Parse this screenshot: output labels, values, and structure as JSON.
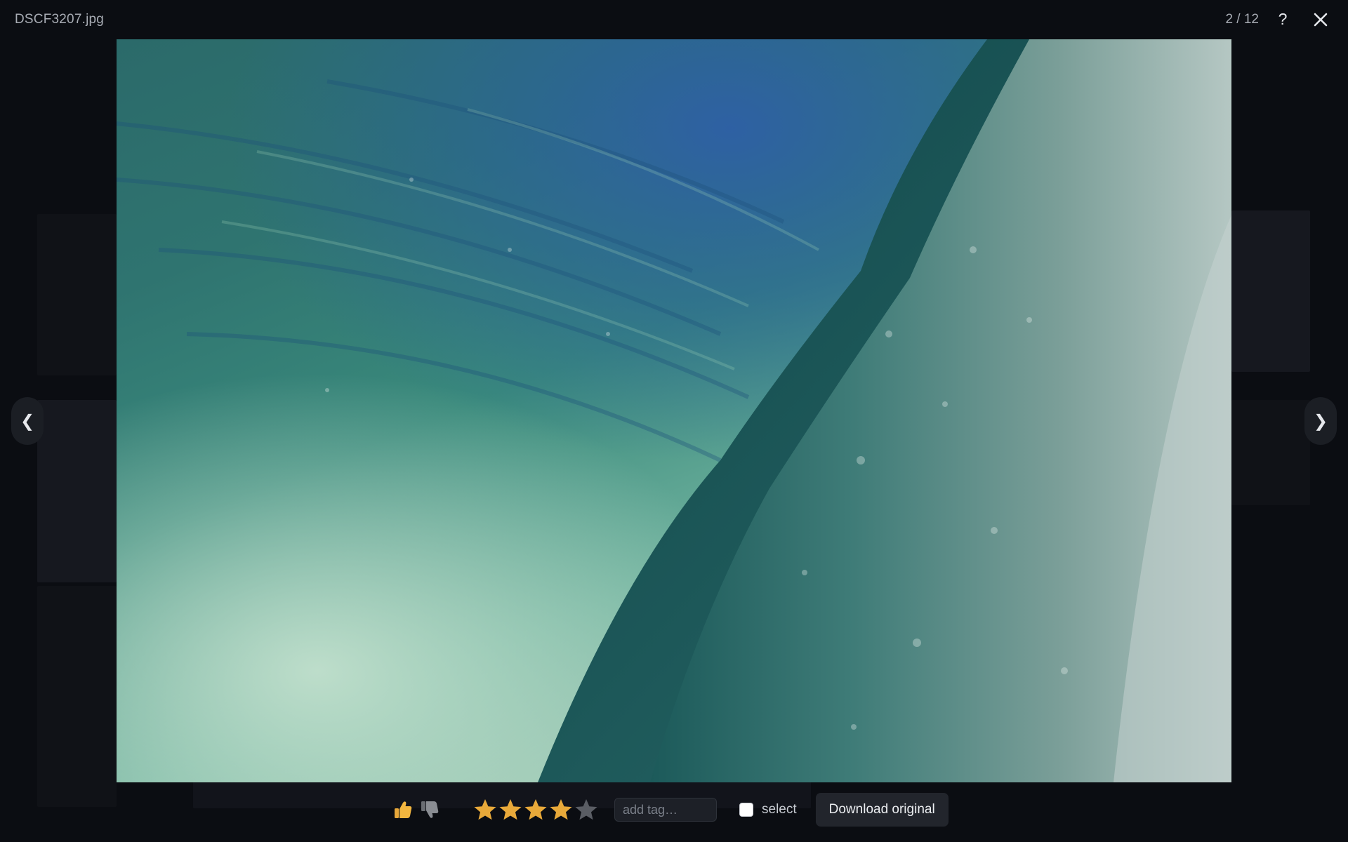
{
  "header": {
    "filename": "DSCF3207.jpg",
    "counter": "2 / 12",
    "help_label": "?"
  },
  "photo": {
    "subject": "underwater view of a breaking ocean wave"
  },
  "navigation": {
    "prev_label": "❮",
    "next_label": "❯"
  },
  "toolbar": {
    "like_icon": "thumbs-up-icon",
    "dislike_icon": "thumbs-down-icon",
    "rating": 4,
    "rating_max": 5,
    "tag_placeholder": "add tag…",
    "select_label": "select",
    "download_label": "Download original"
  },
  "colors": {
    "background": "#0b0d12",
    "star_filled": "#e8a93a",
    "star_empty": "#5a5d64",
    "button_bg": "#22252c"
  }
}
